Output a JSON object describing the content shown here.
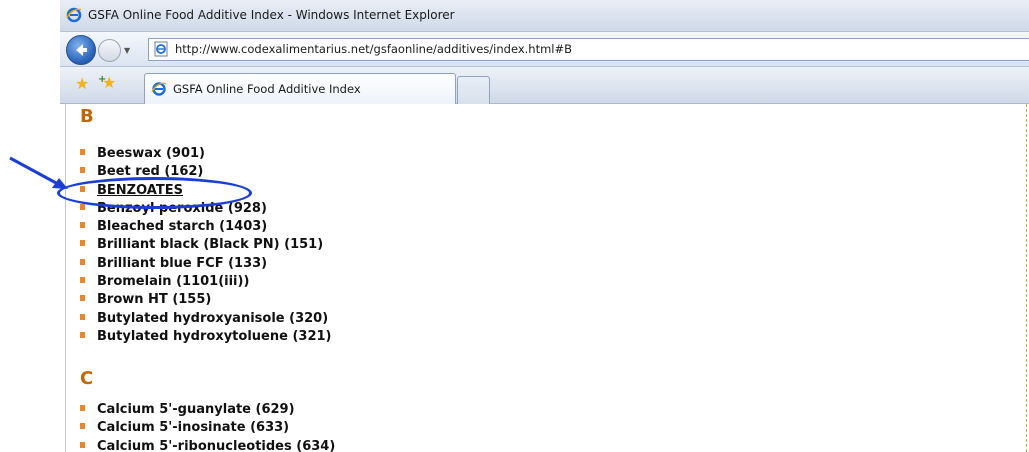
{
  "window": {
    "title": "GSFA Online Food Additive Index - Windows Internet Explorer"
  },
  "address_bar": {
    "url": "http://www.codexalimentarius.net/gsfaonline/additives/index.html#B"
  },
  "tab": {
    "label": "GSFA Online Food Additive Index"
  },
  "sections": [
    {
      "letter": "B",
      "items": [
        "Beeswax (901)",
        "Beet red (162)",
        "BENZOATES",
        "Benzoyl peroxide (928)",
        "Bleached starch (1403)",
        "Brilliant black (Black PN) (151)",
        "Brilliant blue FCF (133)",
        "Bromelain (1101(iii))",
        "Brown HT (155)",
        "Butylated hydroxyanisole (320)",
        "Butylated hydroxytoluene (321)"
      ]
    },
    {
      "letter": "C",
      "items": [
        "Calcium 5'-guanylate (629)",
        "Calcium 5'-inosinate (633)",
        "Calcium 5'-ribonucleotides (634)"
      ]
    }
  ],
  "colors": {
    "section_letter": "#c0670a",
    "bullet": "#e6892e",
    "annotation": "#1b3fd4"
  },
  "icons": {
    "title": "ie-icon",
    "back": "back-arrow-icon",
    "favorites": "star-icon",
    "add_favorites": "add-favorites-icon"
  }
}
